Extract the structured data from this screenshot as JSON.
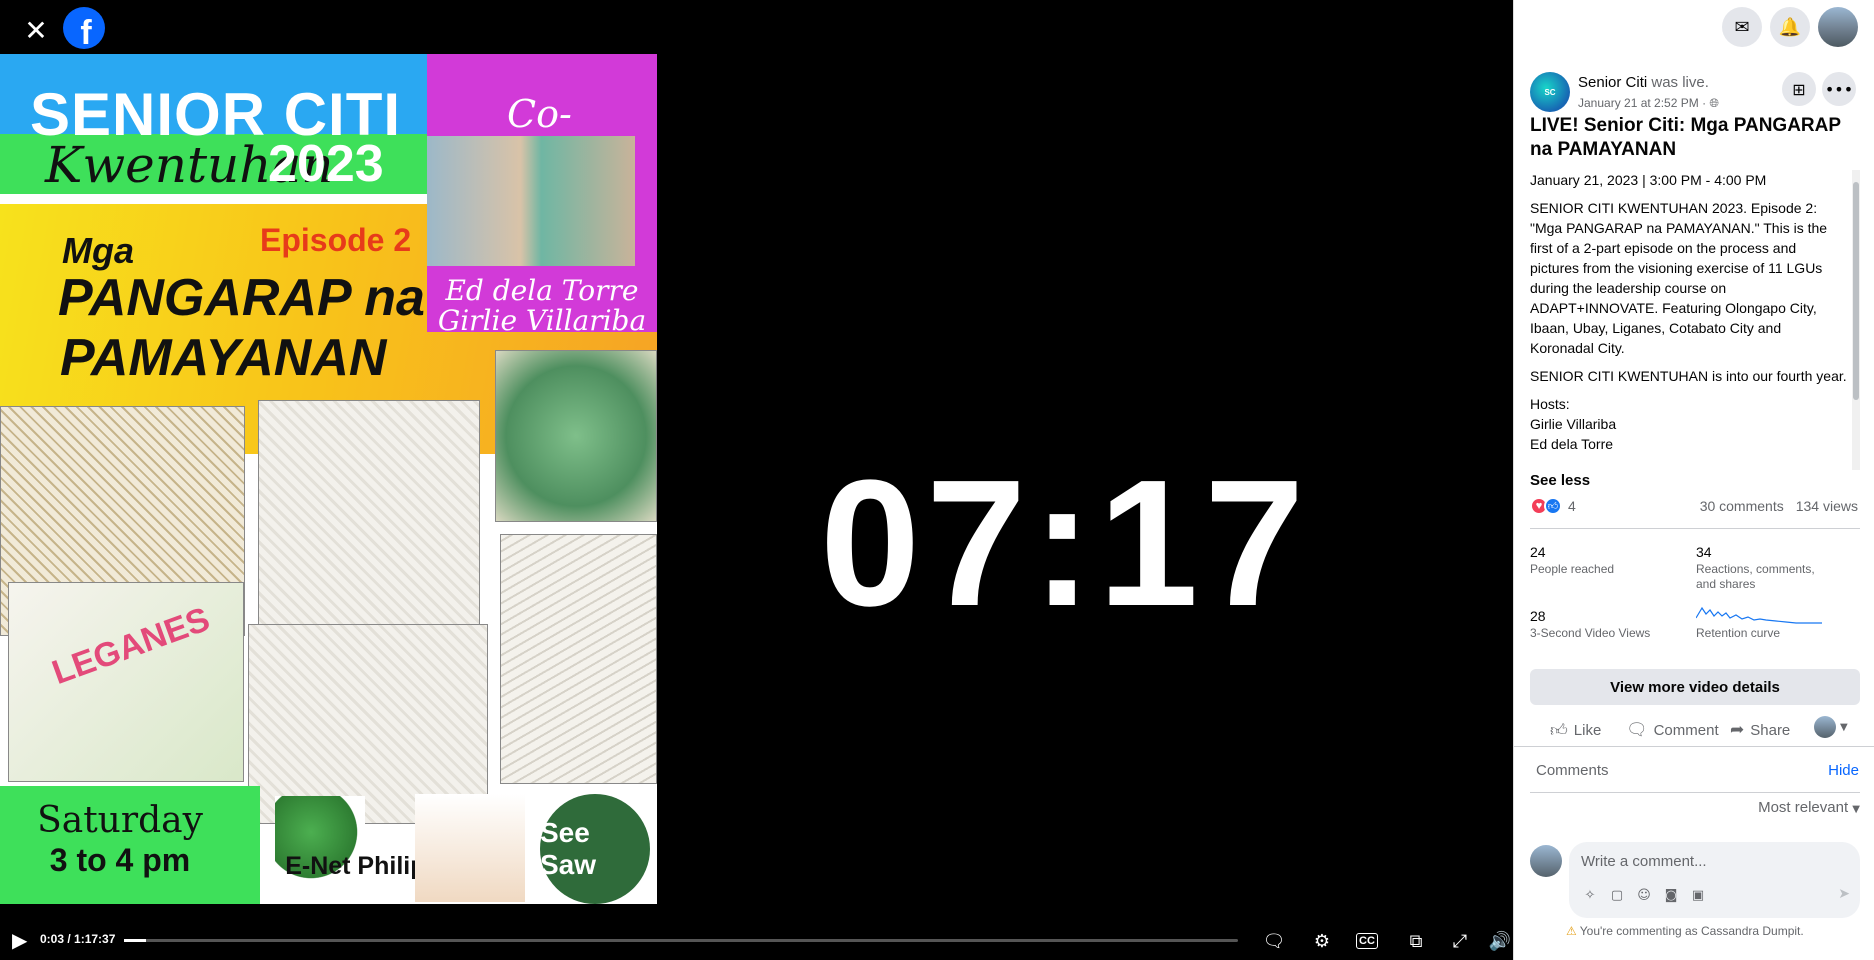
{
  "viewer": {
    "close_icon": "close-icon",
    "logo_letter": "f",
    "poster": {
      "title_line1": "SENIOR CITI",
      "title_kwentuhan": "Kwentuhan",
      "title_year": "2023",
      "cohosts_label": "Co-Hosts",
      "host1": "Ed dela Torre",
      "host2": "Girlie Villariba",
      "episode": "Episode 2",
      "mga": "Mga",
      "pangarap": "PANGARAP na",
      "pamayanan": "PAMAYANAN",
      "leganes": "LEGANES",
      "saturday": "Saturday",
      "time_slot": "3 to 4 pm",
      "enet": "E-Net Philippines",
      "seesaw": "See Saw"
    },
    "countdown": "07:17",
    "controls": {
      "time": "0:03 / 1:17:37",
      "progress_fraction": 0.0006
    }
  },
  "panel": {
    "page_name": "Senior Citi",
    "was_live": "was live.",
    "post_date": "January 21 at 2:52 PM · ",
    "video_title": "LIVE! Senior Citi: Mga PANGARAP na PAMAYANAN",
    "description": [
      "January 21, 2023 | 3:00 PM - 4:00 PM",
      "SENIOR CITI KWENTUHAN 2023. Episode 2: \"Mga PANGARAP na PAMAYANAN.\" This is the first of a 2-part episode on the process and pictures from the visioning exercise of 11 LGUs during the leadership course on ADAPT+INNOVATE. Featuring Olongapo City, Ibaan, Ubay, Liganes, Cotabato City and Koronadal City.",
      "SENIOR CITI KWENTUHAN is into our fourth year.",
      "Hosts:",
      "Girlie Villariba",
      "Ed dela Torre"
    ],
    "see_less": "See less",
    "reaction_count": "4",
    "comments_count": "30 comments",
    "views_count": "134 views",
    "stats": {
      "reached_num": "24",
      "reached_label": "People reached",
      "engage_num": "34",
      "engage_label": "Reactions, comments, and shares",
      "views3_num": "28",
      "views3_label": "3-Second Video Views",
      "retention_label": "Retention curve"
    },
    "view_more": "View more video details",
    "actions": {
      "like": "Like",
      "comment": "Comment",
      "share": "Share"
    },
    "comments_label": "Comments",
    "hide": "Hide",
    "sort": "Most relevant",
    "comment_placeholder": "Write a comment...",
    "commenting_as": "You're commenting as Cassandra Dumpit."
  },
  "colors": {
    "accent": "#0866ff",
    "heart": "#f33e58",
    "like": "#1877f2"
  }
}
